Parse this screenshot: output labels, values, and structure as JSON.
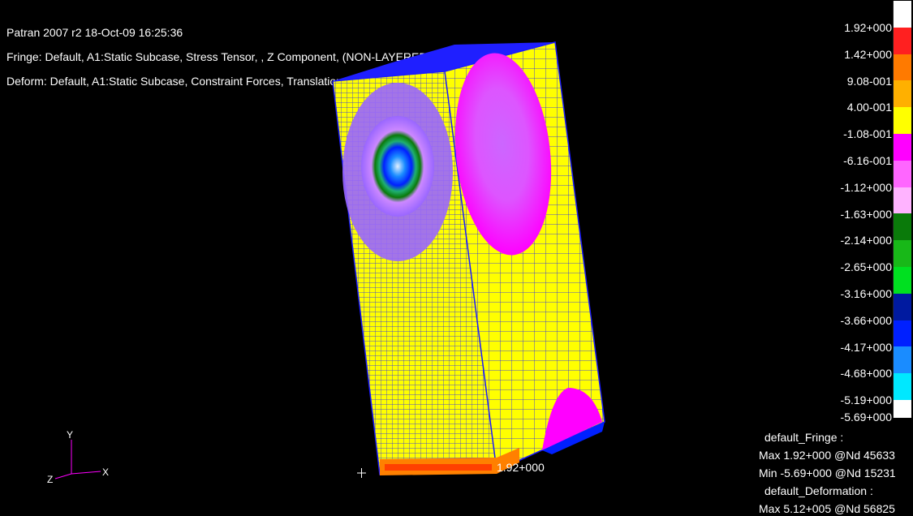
{
  "header": {
    "line1": "Patran 2007 r2 18-Oct-09 16:25:36",
    "line2": "Fringe: Default, A1:Static Subcase, Stress Tensor, , Z Component, (NON-LAYERED)",
    "line3": "Deform: Default, A1:Static Subcase, Constraint Forces, Translational"
  },
  "legend": {
    "colors": [
      "#ffffff",
      "#ff2020",
      "#ff7a00",
      "#ffb000",
      "#ffff00",
      "#ff00ff",
      "#ff66ff",
      "#ffb3ff",
      "#0a7a0a",
      "#18b818",
      "#00e020",
      "#001aa0",
      "#0020ff",
      "#1a8cff",
      "#00e8ff",
      "#ffffff"
    ],
    "labels": [
      "1.92+000",
      "1.42+000",
      "9.08-001",
      "4.00-001",
      "-1.08-001",
      "-6.16-001",
      "-1.12+000",
      "-1.63+000",
      "-2.14+000",
      "-2.65+000",
      "-3.16+000",
      "-3.66+000",
      "-4.17+000",
      "-4.68+000",
      "-5.19+000",
      "-5.69+000"
    ]
  },
  "summary": {
    "fringe_title": "default_Fringe :",
    "fringe_max": "Max 1.92+000 @Nd 45633",
    "fringe_min": "Min -5.69+000 @Nd 15231",
    "deform_title": "default_Deformation :",
    "deform_max": "Max 5.12+005 @Nd 56825"
  },
  "model": {
    "max_marker_label": "1.92+000",
    "colors": {
      "base": "#ffff00",
      "mesh": "#1a1aff",
      "top": "#1f1fff",
      "magenta": "#ff00ff",
      "violet": "#9966ff",
      "teal": "#20b070",
      "blue": "#0044ff",
      "orange": "#ff8000"
    }
  },
  "axes": {
    "x": "X",
    "y": "Y",
    "z": "Z"
  }
}
